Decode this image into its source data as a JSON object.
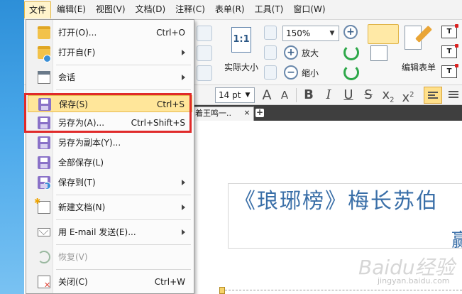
{
  "menubar": {
    "items": [
      "文件",
      "编辑(E)",
      "视图(V)",
      "文档(D)",
      "注释(C)",
      "表单(R)",
      "工具(T)",
      "窗口(W)"
    ]
  },
  "ribbon": {
    "zoom_value": "150%",
    "actual_size_icon_text": "1:1",
    "actual_size_label": "实际大小",
    "zoom_in_label": "放大",
    "zoom_out_label": "缩小",
    "edit_form_label": "编辑表单",
    "text_field_icon_text": "T"
  },
  "format_bar": {
    "font_size": "14 pt",
    "grow_font": "A",
    "shrink_font": "A",
    "bold": "B",
    "italic": "I",
    "underline": "U",
    "strikethrough": "S",
    "subscript_main": "x",
    "subscript_mark": "2",
    "superscript_main": "x",
    "superscript_mark": "2"
  },
  "tabs": {
    "doc_tab_label": "着王鸣一..",
    "close_glyph": "×",
    "new_tab_glyph": "+"
  },
  "file_menu": {
    "items": [
      {
        "label": "打开(O)...",
        "shortcut": "Ctrl+O",
        "icon": "folder-icon"
      },
      {
        "label": "打开自(F)",
        "shortcut": "",
        "icon": "folder-globe-icon",
        "submenu": true
      },
      {
        "label": "会话",
        "shortcut": "",
        "icon": "calendar-icon",
        "submenu": true
      },
      {
        "label": "保存(S)",
        "shortcut": "Ctrl+S",
        "icon": "floppy-icon",
        "highlighted": true
      },
      {
        "label": "另存为(A)...",
        "shortcut": "Ctrl+Shift+S",
        "icon": "floppy-pencil-icon"
      },
      {
        "label": "另存为副本(Y)...",
        "shortcut": "",
        "icon": "floppy-copy-icon"
      },
      {
        "label": "全部保存(L)",
        "shortcut": "",
        "icon": "floppy-stack-icon"
      },
      {
        "label": "保存到(T)",
        "shortcut": "",
        "icon": "floppy-globe-icon",
        "submenu": true
      },
      {
        "label": "新建文档(N)",
        "shortcut": "",
        "icon": "new-document-icon",
        "submenu": true
      },
      {
        "label": "用 E-mail 发送(E)...",
        "shortcut": "",
        "icon": "mail-icon",
        "submenu": true
      },
      {
        "label": "恢复(V)",
        "shortcut": "",
        "icon": "restore-icon",
        "disabled": true
      },
      {
        "label": "关闭(C)",
        "shortcut": "Ctrl+W",
        "icon": "close-document-icon"
      }
    ]
  },
  "document": {
    "title_line": "《琅琊榜》梅长苏伯",
    "second_line": "赢"
  },
  "watermark": {
    "text": "Baidu经验",
    "sub": "jingyan.baidu.com"
  },
  "colors": {
    "highlight": "#ffe69a",
    "annotation_box": "#e02a2a",
    "doc_text": "#3a6fa8"
  }
}
